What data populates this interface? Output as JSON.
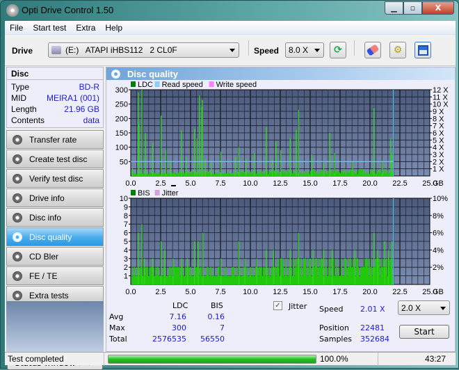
{
  "window": {
    "title": "Opti Drive Control 1.50",
    "buttons": {
      "minimize": "—",
      "maximize": "□",
      "close": "X"
    }
  },
  "menu": [
    "File",
    "Start test",
    "Extra",
    "Help"
  ],
  "toolbar": {
    "drive_label": "Drive",
    "drive_value": "(E:)   ATAPI iHBS112   2 CL0F",
    "speed_label": "Speed",
    "speed_value": "8.0 X",
    "icons": [
      "refresh-icon",
      "eraser-icon",
      "settings-icon",
      "save-icon"
    ]
  },
  "disc": {
    "header": "Disc",
    "rows": [
      {
        "key": "Type",
        "value": "BD-R"
      },
      {
        "key": "MID",
        "value": "MEIRA1 (001)"
      },
      {
        "key": "Length",
        "value": "21.96 GB"
      },
      {
        "key": "Contents",
        "value": "data"
      }
    ]
  },
  "nav": [
    {
      "label": "Transfer rate",
      "active": false
    },
    {
      "label": "Create test disc",
      "active": false
    },
    {
      "label": "Verify test disc",
      "active": false
    },
    {
      "label": "Drive info",
      "active": false
    },
    {
      "label": "Disc info",
      "active": false
    },
    {
      "label": "Disc quality",
      "active": true
    },
    {
      "label": "CD Bler",
      "active": false
    },
    {
      "label": "FE / TE",
      "active": false
    },
    {
      "label": "Extra tests",
      "active": false
    }
  ],
  "status_window_button": "Status window > >",
  "main": {
    "title": "Disc quality",
    "stats": {
      "col_headers": [
        "LDC",
        "BIS"
      ],
      "rows": [
        {
          "label": "Avg",
          "ldc": "7.16",
          "bis": "0.16"
        },
        {
          "label": "Max",
          "ldc": "300",
          "bis": "7"
        },
        {
          "label": "Total",
          "ldc": "2576535",
          "bis": "56550"
        }
      ],
      "jitter_label": "Jitter",
      "jitter_checked": true,
      "speed_label": "Speed",
      "speed_value": "2.01 X",
      "speed_select": "2.0 X",
      "position_label": "Position",
      "position_value": "22481",
      "samples_label": "Samples",
      "samples_value": "352684",
      "start_button": "Start"
    }
  },
  "statusbar": {
    "status": "Test completed",
    "progress": 100.0,
    "progress_text": "100.0%",
    "time": "43:27"
  },
  "chart_data": [
    {
      "type": "bar",
      "title": "LDC",
      "legend": [
        {
          "name": "LDC",
          "color": "#008000"
        },
        {
          "name": "Read speed",
          "color": "#87cefa"
        },
        {
          "name": "Write speed",
          "color": "#ff80ff"
        }
      ],
      "legend_position": "top-left",
      "xlabel": "GB",
      "x_ticks": [
        "0.0",
        "2.5",
        "5.0",
        "7.5",
        "10.0",
        "12.5",
        "15.0",
        "17.5",
        "20.0",
        "22.5",
        "25.0"
      ],
      "xlim": [
        0,
        25
      ],
      "y_ticks": [
        "50",
        "100",
        "150",
        "200",
        "250",
        "300"
      ],
      "ylim": [
        0,
        300
      ],
      "y2_ticks": [
        "1 X",
        "2 X",
        "3 X",
        "4 X",
        "5 X",
        "6 X",
        "7 X",
        "8 X",
        "9 X",
        "10 X",
        "11 X",
        "12 X"
      ],
      "y2lim": [
        0,
        12
      ],
      "end_marker_gb": 21.96,
      "read_speed_x": 2.0,
      "peaks": [
        [
          0.1,
          28
        ],
        [
          0.6,
          290
        ],
        [
          0.65,
          180
        ],
        [
          0.9,
          300
        ],
        [
          1.2,
          150
        ],
        [
          1.8,
          115
        ],
        [
          2.5,
          210
        ],
        [
          2.9,
          90
        ],
        [
          3.3,
          50
        ],
        [
          4.2,
          160
        ],
        [
          4.6,
          65
        ],
        [
          5.3,
          165
        ],
        [
          5.5,
          130
        ],
        [
          5.7,
          280
        ],
        [
          5.9,
          240
        ],
        [
          5.95,
          265
        ],
        [
          6.2,
          60
        ],
        [
          6.7,
          50
        ],
        [
          7.5,
          85
        ],
        [
          8.7,
          65
        ],
        [
          9.0,
          100
        ],
        [
          9.6,
          60
        ],
        [
          10.3,
          80
        ],
        [
          11.3,
          170
        ],
        [
          11.8,
          60
        ],
        [
          12.1,
          120
        ],
        [
          12.5,
          90
        ],
        [
          13.3,
          130
        ],
        [
          13.8,
          160
        ],
        [
          14.0,
          230
        ],
        [
          15.1,
          75
        ],
        [
          16.1,
          45
        ],
        [
          16.6,
          150
        ],
        [
          17.0,
          80
        ],
        [
          18.5,
          50
        ],
        [
          20.3,
          235
        ],
        [
          21.0,
          50
        ],
        [
          21.7,
          130
        ],
        [
          21.8,
          80
        ]
      ],
      "baseline": 10
    },
    {
      "type": "bar",
      "title": "BIS",
      "legend": [
        {
          "name": "BIS",
          "color": "#008000"
        },
        {
          "name": "Jitter",
          "color": "#d8a0d8"
        }
      ],
      "legend_position": "top-left",
      "xlabel": "GB",
      "x_ticks": [
        "0.0",
        "2.5",
        "5.0",
        "7.5",
        "10.0",
        "12.5",
        "15.0",
        "17.5",
        "20.0",
        "22.5",
        "25.0"
      ],
      "xlim": [
        0,
        25
      ],
      "y_ticks": [
        "1",
        "2",
        "3",
        "4",
        "5",
        "6",
        "7",
        "8",
        "9",
        "10"
      ],
      "ylim": [
        0,
        10
      ],
      "y2_ticks": [
        "2%",
        "4%",
        "6%",
        "8%",
        "10%"
      ],
      "y2lim": [
        0,
        10
      ],
      "end_marker_gb": 21.96,
      "peaks": [
        [
          0.6,
          6
        ],
        [
          0.9,
          7
        ],
        [
          1.1,
          3
        ],
        [
          1.8,
          3
        ],
        [
          2.5,
          5
        ],
        [
          2.8,
          4
        ],
        [
          3.5,
          3
        ],
        [
          4.2,
          3
        ],
        [
          4.7,
          3
        ],
        [
          5.3,
          5
        ],
        [
          5.6,
          5
        ],
        [
          6.0,
          6
        ],
        [
          7.5,
          3
        ],
        [
          9.0,
          5
        ],
        [
          9.5,
          3
        ],
        [
          10.5,
          3
        ],
        [
          11.3,
          4
        ],
        [
          11.9,
          4
        ],
        [
          12.5,
          3
        ],
        [
          13.3,
          4
        ],
        [
          14.0,
          6
        ],
        [
          15.2,
          4
        ],
        [
          16.1,
          4
        ],
        [
          16.8,
          4
        ],
        [
          18.7,
          4
        ],
        [
          20.3,
          6
        ],
        [
          20.6,
          4
        ],
        [
          21.2,
          5
        ],
        [
          21.5,
          4
        ],
        [
          21.8,
          5
        ]
      ],
      "baseline": 2
    }
  ]
}
